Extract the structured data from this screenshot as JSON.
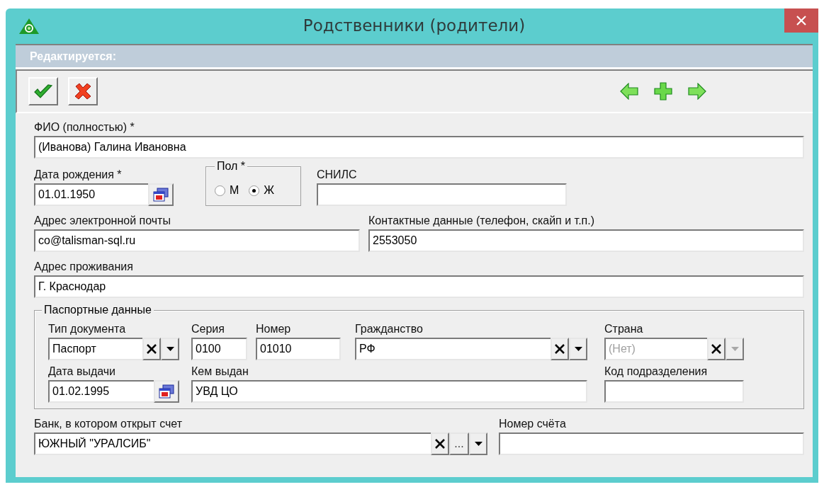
{
  "window": {
    "title": "Родственники (родители)"
  },
  "status_banner": "Редактируется:",
  "fio": {
    "label": "ФИО (полностью) *",
    "value": "(Иванова) Галина Ивановна"
  },
  "birth_date": {
    "label": "Дата рождения *",
    "value": "01.01.1950"
  },
  "gender": {
    "legend": "Пол *",
    "options": [
      {
        "label": "М",
        "selected": false
      },
      {
        "label": "Ж",
        "selected": true
      }
    ]
  },
  "snils": {
    "label": "СНИЛС"
  },
  "email": {
    "label": "Адрес электронной почты",
    "value": "co@talisman-sql.ru"
  },
  "contacts": {
    "label": "Контактные данные (телефон, скайп и т.п.)",
    "value": "2553050"
  },
  "address": {
    "label": "Адрес проживания",
    "value": "Г. Краснодар"
  },
  "passport": {
    "legend": "Паспортные данные",
    "doc_type": {
      "label": "Тип документа",
      "value": "Паспорт",
      "disabled": false
    },
    "series": {
      "label": "Серия",
      "value": "0100"
    },
    "number": {
      "label": "Номер",
      "value": "01010"
    },
    "citizenship": {
      "label": "Гражданство",
      "value": "РФ",
      "disabled": false
    },
    "country": {
      "label": "Страна",
      "value": "(Нет)",
      "disabled": true
    },
    "issue_date": {
      "label": "Дата выдачи",
      "value": "01.02.1995"
    },
    "issued_by": {
      "label": "Кем выдан",
      "value": "УВД ЦО"
    },
    "division_code": {
      "label": "Код подразделения"
    }
  },
  "bank": {
    "label": "Банк, в котором открыт счет",
    "value": "ЮЖНЫЙ \"УРАЛСИБ\"",
    "browse_button": "...",
    "disabled": false
  },
  "account_number": {
    "label": "Номер счёта"
  }
}
